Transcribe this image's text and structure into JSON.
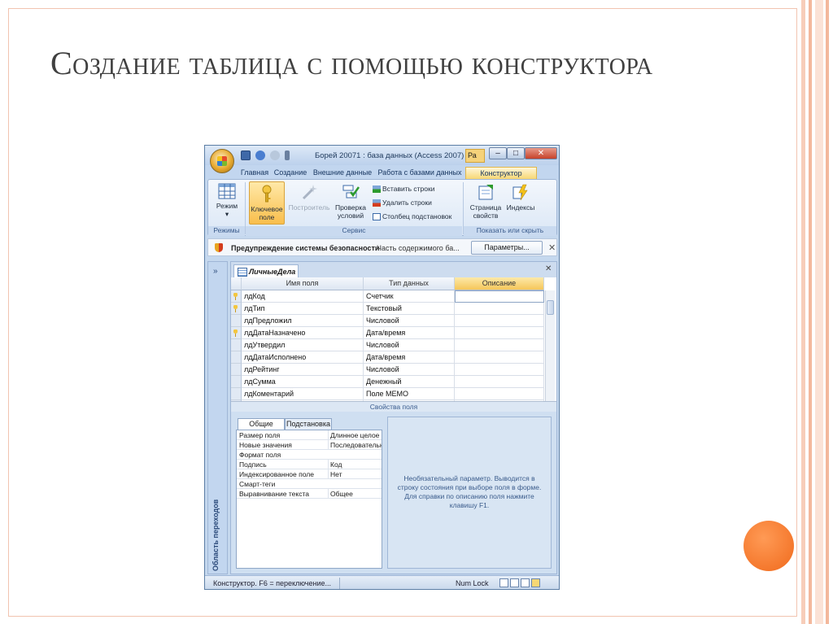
{
  "slide": {
    "title": "Создание таблица с помощью конструктора"
  },
  "window": {
    "title": "Борей 20071 : база данных (Access 2007) ...",
    "title_tab": "Ра",
    "controls": {
      "minimize": "–",
      "maximize": "□",
      "close": "✕"
    }
  },
  "tabs": [
    {
      "label": "Главная"
    },
    {
      "label": "Создание"
    },
    {
      "label": "Внешние данные"
    },
    {
      "label": "Работа с базами данных"
    },
    {
      "label": "Конструктор"
    }
  ],
  "ribbon": {
    "buttons": {
      "mode": "Режим",
      "key_field": "Ключевое поле",
      "builder": "Построитель",
      "check": "Проверка условий",
      "page": "Страница свойств",
      "indexes": "Индексы"
    },
    "small": {
      "insert_rows": "Вставить строки",
      "delete_rows": "Удалить строки",
      "lookup_column": "Столбец подстановок"
    },
    "groups": {
      "modes": "Режимы",
      "service": "Сервис",
      "show_hide": "Показать или скрыть"
    }
  },
  "security": {
    "warning": "Предупреждение системы безопасности",
    "message": "Часть содержимого ба...",
    "button": "Параметры...",
    "close": "✕"
  },
  "nav_pane": {
    "chevron": "»",
    "label": "Область переходов"
  },
  "document": {
    "tab": "ЛичныеДела",
    "close": "✕",
    "columns": [
      "Имя поля",
      "Тип данных",
      "Описание"
    ],
    "rows": [
      {
        "name": "лдКод",
        "type": "Счетчик",
        "desc": "",
        "key": true
      },
      {
        "name": "лдТип",
        "type": "Текстовый",
        "desc": "",
        "key": true
      },
      {
        "name": "лдПредложил",
        "type": "Числовой",
        "desc": "",
        "key": false
      },
      {
        "name": "лдДатаНазначено",
        "type": "Дата/время",
        "desc": "",
        "key": true
      },
      {
        "name": "лдУтвердил",
        "type": "Числовой",
        "desc": "",
        "key": false
      },
      {
        "name": "лдДатаИсполнено",
        "type": "Дата/время",
        "desc": "",
        "key": false
      },
      {
        "name": "лдРейтинг",
        "type": "Числовой",
        "desc": "",
        "key": false
      },
      {
        "name": "лдСумма",
        "type": "Денежный",
        "desc": "",
        "key": false
      },
      {
        "name": "лдКоментарий",
        "type": "Поле MEMO",
        "desc": "",
        "key": false
      }
    ]
  },
  "properties": {
    "title": "Свойства поля",
    "tabs": [
      "Общие",
      "Подстановка"
    ],
    "rows": [
      {
        "k": "Размер поля",
        "v": "Длинное целое"
      },
      {
        "k": "Новые значения",
        "v": "Последовательные"
      },
      {
        "k": "Формат поля",
        "v": ""
      },
      {
        "k": "Подпись",
        "v": "Код"
      },
      {
        "k": "Индексированное поле",
        "v": "Нет"
      },
      {
        "k": "Смарт-теги",
        "v": ""
      },
      {
        "k": "Выравнивание текста",
        "v": "Общее"
      }
    ],
    "help": "Необязательный параметр. Выводится в строку состояния при выборе поля в форме. Для справки по описанию поля нажмите клавишу F1."
  },
  "status": {
    "left": "Конструктор.  F6 = переключение...",
    "num_lock": "Num Lock"
  },
  "colors": {
    "accent_orange": "#f06a1c",
    "frame": "#f2c4b0",
    "ribbon_blue": "#c5d8ee",
    "context_tab": "#f7d774"
  }
}
